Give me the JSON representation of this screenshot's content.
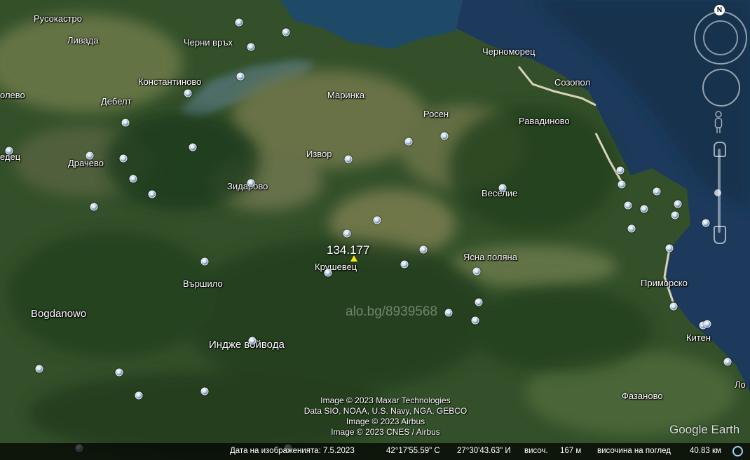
{
  "map": {
    "places": [
      {
        "name": "Русокастро"
      },
      {
        "name": "Ливада"
      },
      {
        "name": "Черни връх"
      },
      {
        "name": "Константиново"
      },
      {
        "name": "олево"
      },
      {
        "name": "Дебелт"
      },
      {
        "name": "Маринка"
      },
      {
        "name": "Росен"
      },
      {
        "name": "Черноморец"
      },
      {
        "name": "Созопол"
      },
      {
        "name": "Равадиново"
      },
      {
        "name": "едец"
      },
      {
        "name": "Драчево"
      },
      {
        "name": "Извор"
      },
      {
        "name": "Зидарово"
      },
      {
        "name": "Веселие"
      },
      {
        "name": "Крушевец"
      },
      {
        "name": "Ясна поляна"
      },
      {
        "name": "Приморско"
      },
      {
        "name": "Вършило"
      },
      {
        "name": "Bogdanowo"
      },
      {
        "name": "Индже войвода"
      },
      {
        "name": "Китен"
      },
      {
        "name": "Фазаново"
      },
      {
        "name": "Ло"
      }
    ],
    "elevation_label": "134.177",
    "watermark": "alo.bg/8939568",
    "pin_icon": "photo-pin-icon",
    "marker_icon": "yellow-pushpin-icon"
  },
  "credits": [
    "Image © 2023 Maxar Technologies",
    "Data SIO, NOAA, U.S. Navy, NGA, GEBCO",
    "Image © 2023 Airbus",
    "Image © 2023 CNES / Airbus"
  ],
  "logo": "Google Earth",
  "status": {
    "date": "Дата на изображенията: 7.5.2023",
    "lat": "42°17'55.59\" С",
    "lon": "27°30'43.63\" И",
    "elev_label": "височ.",
    "elev_value": "167 м",
    "eye_label": "височина на поглед",
    "eye_value": "40.83 км"
  },
  "nav": {
    "north_label": "N"
  },
  "colors": {
    "sea": "#1d3a5c",
    "forest": "#2f4a26",
    "field": "#6f7a4a",
    "marker": "#ffe600"
  }
}
